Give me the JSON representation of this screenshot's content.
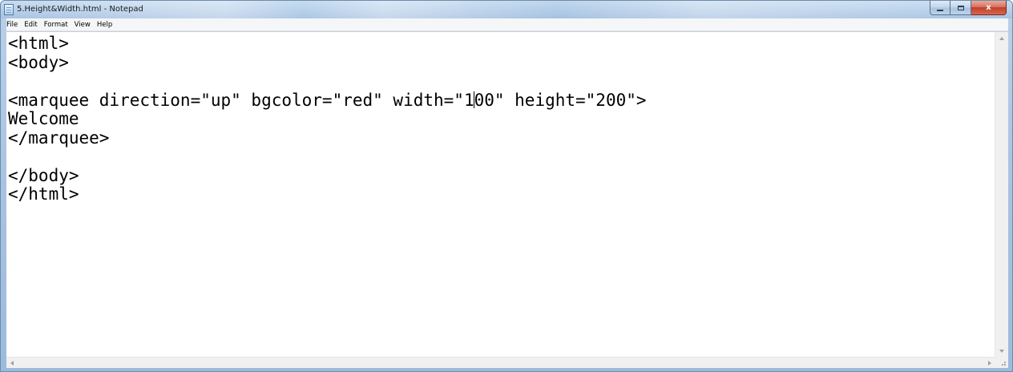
{
  "window": {
    "title": "5.Height&Width.html - Notepad",
    "app_icon": "notepad-icon",
    "frame_color": "#a9c4e2",
    "close_color": "#c0402a"
  },
  "caption_buttons": {
    "minimize_icon": "minimize-icon",
    "maximize_icon": "maximize-icon",
    "close_icon": "close-icon",
    "close_glyph": "x"
  },
  "menu": {
    "items": [
      "File",
      "Edit",
      "Format",
      "View",
      "Help"
    ]
  },
  "editor": {
    "lines": [
      "<html>",
      "<body>",
      "",
      "<marquee direction=\"up\" bgcolor=\"red\" width=\"1",
      "Welcome",
      "</marquee>",
      "",
      "</body>",
      "</html>"
    ],
    "caret_line_rest": "00\" height=\"200\">"
  },
  "scrollbars": {
    "vertical": {
      "up_icon": "scroll-up-arrow-icon",
      "down_icon": "scroll-down-arrow-icon"
    },
    "horizontal": {
      "left_icon": "scroll-left-arrow-icon",
      "right_icon": "scroll-right-arrow-icon"
    }
  }
}
